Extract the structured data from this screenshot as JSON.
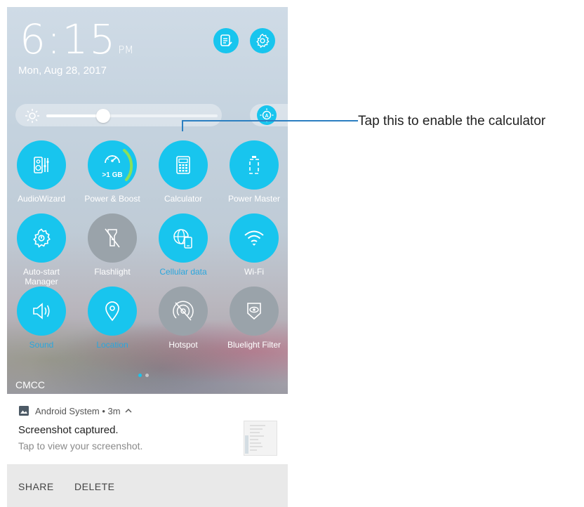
{
  "status": {
    "time_hm": "6:15",
    "ampm": "PM",
    "date": "Mon, Aug 28, 2017"
  },
  "top_buttons": [
    {
      "icon": "edit-list-icon"
    },
    {
      "icon": "gear-icon"
    }
  ],
  "brightness": {
    "level": 0.33,
    "auto_icon": "auto-brightness-icon"
  },
  "tiles": [
    {
      "label": "AudioWizard",
      "icon": "audiowizard-icon",
      "state": "on",
      "label_color": "white"
    },
    {
      "label": "Power & Boost",
      "icon": "speedometer-icon",
      "state": "on",
      "label_color": "white",
      "badge": ">1 GB"
    },
    {
      "label": "Calculator",
      "icon": "calculator-icon",
      "state": "on",
      "label_color": "white"
    },
    {
      "label": "Power Master",
      "icon": "battery-icon",
      "state": "on",
      "label_color": "white"
    },
    {
      "label": "Auto-start Manager",
      "icon": "gear-icon",
      "state": "on",
      "label_color": "white"
    },
    {
      "label": "Flashlight",
      "icon": "flashlight-off-icon",
      "state": "off",
      "label_color": "white"
    },
    {
      "label": "Cellular data",
      "icon": "cellular-data-icon",
      "state": "on",
      "label_color": "blue"
    },
    {
      "label": "Wi-Fi",
      "icon": "wifi-icon",
      "state": "on",
      "label_color": "white"
    },
    {
      "label": "Sound",
      "icon": "speaker-icon",
      "state": "on",
      "label_color": "blue"
    },
    {
      "label": "Location",
      "icon": "location-pin-icon",
      "state": "on",
      "label_color": "blue"
    },
    {
      "label": "Hotspot",
      "icon": "hotspot-off-icon",
      "state": "off",
      "label_color": "white"
    },
    {
      "label": "Bluelight Filter",
      "icon": "bluelight-filter-icon",
      "state": "off",
      "label_color": "white"
    }
  ],
  "carrier": "CMCC",
  "notification": {
    "app": "Android System",
    "sep": " • ",
    "age": "3m",
    "title": "Screenshot captured.",
    "text": "Tap to view your screenshot.",
    "actions": [
      "SHARE",
      "DELETE"
    ]
  },
  "callout": {
    "text": "Tap this to enable the calculator"
  },
  "colors": {
    "accent": "#18c5ee",
    "off": "#9aa3aa",
    "callout_line": "#2b7fc1"
  }
}
